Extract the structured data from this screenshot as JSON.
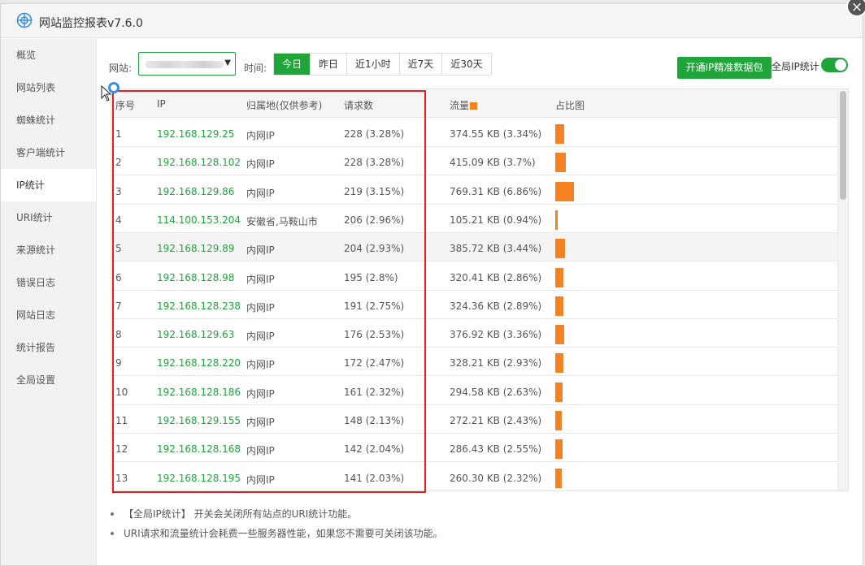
{
  "app": {
    "title": "网站监控报表v7.6.0",
    "close_label": "×"
  },
  "sidebar": {
    "items": [
      {
        "label": "概览",
        "active": false
      },
      {
        "label": "网站列表",
        "active": false
      },
      {
        "label": "蜘蛛统计",
        "active": false
      },
      {
        "label": "客户端统计",
        "active": false
      },
      {
        "label": "IP统计",
        "active": true
      },
      {
        "label": "URI统计",
        "active": false
      },
      {
        "label": "来源统计",
        "active": false
      },
      {
        "label": "错误日志",
        "active": false
      },
      {
        "label": "网站日志",
        "active": false
      },
      {
        "label": "统计报告",
        "active": false
      },
      {
        "label": "全局设置",
        "active": false
      }
    ]
  },
  "filters": {
    "site_label": "网站:",
    "time_label": "时间:",
    "time_options": [
      "今日",
      "昨日",
      "近1小时",
      "近7天",
      "近30天"
    ],
    "time_active": 0,
    "open_button": "开通IP精准数据包",
    "global_ip_label": "全局IP统计",
    "global_ip_on": true
  },
  "table": {
    "headers": {
      "no": "序号",
      "ip": "IP",
      "location": "归属地(仅供参考)",
      "requests": "请求数",
      "flow": "流量",
      "ratio": "占比图"
    },
    "rows": [
      {
        "no": "1",
        "ip": "192.168.129.25",
        "location": "内网IP",
        "requests": "228 (3.28%)",
        "flow": "374.55 KB (3.34%)",
        "flow_pct": 3.34
      },
      {
        "no": "2",
        "ip": "192.168.128.102",
        "location": "内网IP",
        "requests": "228 (3.28%)",
        "flow": "415.09 KB (3.7%)",
        "flow_pct": 3.7
      },
      {
        "no": "3",
        "ip": "192.168.129.86",
        "location": "内网IP",
        "requests": "219 (3.15%)",
        "flow": "769.31 KB (6.86%)",
        "flow_pct": 6.86
      },
      {
        "no": "4",
        "ip": "114.100.153.204",
        "location": "安徽省,马鞍山市",
        "requests": "206 (2.96%)",
        "flow": "105.21 KB (0.94%)",
        "flow_pct": 0.94
      },
      {
        "no": "5",
        "ip": "192.168.129.89",
        "location": "内网IP",
        "requests": "204 (2.93%)",
        "flow": "385.72 KB (3.44%)",
        "flow_pct": 3.44
      },
      {
        "no": "6",
        "ip": "192.168.128.98",
        "location": "内网IP",
        "requests": "195 (2.8%)",
        "flow": "320.41 KB (2.86%)",
        "flow_pct": 2.86
      },
      {
        "no": "7",
        "ip": "192.168.128.238",
        "location": "内网IP",
        "requests": "191 (2.75%)",
        "flow": "324.36 KB (2.89%)",
        "flow_pct": 2.89
      },
      {
        "no": "8",
        "ip": "192.168.129.63",
        "location": "内网IP",
        "requests": "176 (2.53%)",
        "flow": "376.92 KB (3.36%)",
        "flow_pct": 3.36
      },
      {
        "no": "9",
        "ip": "192.168.128.220",
        "location": "内网IP",
        "requests": "172 (2.47%)",
        "flow": "328.21 KB (2.93%)",
        "flow_pct": 2.93
      },
      {
        "no": "10",
        "ip": "192.168.128.186",
        "location": "内网IP",
        "requests": "161 (2.32%)",
        "flow": "294.58 KB (2.63%)",
        "flow_pct": 2.63
      },
      {
        "no": "11",
        "ip": "192.168.129.155",
        "location": "内网IP",
        "requests": "148 (2.13%)",
        "flow": "272.21 KB (2.43%)",
        "flow_pct": 2.43
      },
      {
        "no": "12",
        "ip": "192.168.128.168",
        "location": "内网IP",
        "requests": "142 (2.04%)",
        "flow": "286.43 KB (2.55%)",
        "flow_pct": 2.55
      },
      {
        "no": "13",
        "ip": "192.168.128.195",
        "location": "内网IP",
        "requests": "141 (2.03%)",
        "flow": "260.30 KB (2.32%)",
        "flow_pct": 2.32
      }
    ]
  },
  "notes": [
    "【全局IP统计】 开关会关闭所有站点的URI统计功能。",
    "URI请求和流量统计会耗费一些服务器性能，如果您不需要可关闭该功能。"
  ],
  "colors": {
    "accent": "#20a53a",
    "bar": "#f58220",
    "highlight": "#e02020"
  }
}
